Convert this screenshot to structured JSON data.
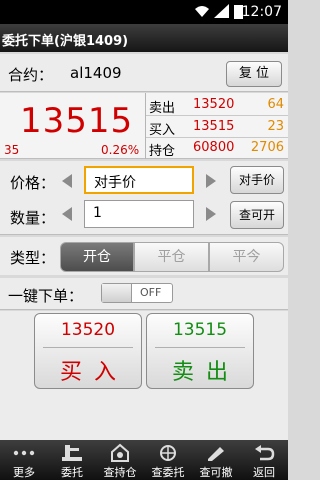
{
  "status": {
    "time": "12:07"
  },
  "title": "委托下单(沪银1409)",
  "contract": {
    "label": "合约：",
    "value": "al1409",
    "reset_label": "复 位"
  },
  "quote": {
    "price": "13515",
    "change": "35",
    "change_pct": "0.26%",
    "rows": [
      {
        "name": "卖出",
        "price": "13520",
        "qty": "64"
      },
      {
        "name": "买入",
        "price": "13515",
        "qty": "23"
      },
      {
        "name": "持仓",
        "price": "60800",
        "qty": "2706"
      }
    ]
  },
  "price_field": {
    "label": "价格：",
    "value": "对手价",
    "button": "对手价"
  },
  "qty_field": {
    "label": "数量：",
    "value": "1",
    "button": "查可开"
  },
  "type": {
    "label": "类型：",
    "options": [
      "开仓",
      "平仓",
      "平今"
    ],
    "selected": "开仓"
  },
  "one_click": {
    "label": "一键下单：",
    "state": "OFF"
  },
  "buy": {
    "price": "13520",
    "label": "买入"
  },
  "sell": {
    "price": "13515",
    "label": "卖出"
  },
  "nav": [
    {
      "label": "更多",
      "icon": "more-icon"
    },
    {
      "label": "委托",
      "icon": "order-icon"
    },
    {
      "label": "查持仓",
      "icon": "position-icon"
    },
    {
      "label": "查委托",
      "icon": "query-order-icon"
    },
    {
      "label": "查可撤",
      "icon": "cancel-icon"
    },
    {
      "label": "返回",
      "icon": "back-icon"
    }
  ],
  "colors": {
    "up": "#d10000",
    "down": "#138d13",
    "qty": "#e08a00",
    "focus": "#f1a400"
  }
}
